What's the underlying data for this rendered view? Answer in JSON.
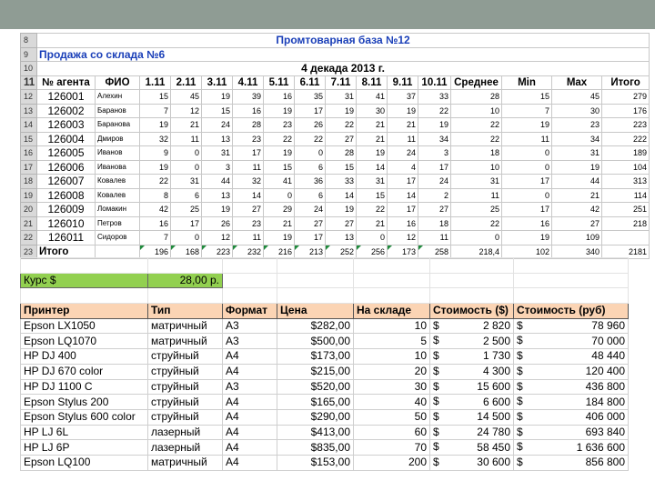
{
  "sheet1": {
    "row_numbers": [
      "8",
      "9",
      "10",
      "11",
      "12",
      "13",
      "14",
      "15",
      "16",
      "17",
      "18",
      "19",
      "20",
      "21",
      "22",
      "23"
    ],
    "title": "Промтоварная база №12",
    "subtitle": "Продажа со склада №6",
    "decade": "4 декада 2013 г.",
    "headers": [
      "№ агента",
      "ФИО",
      "1.11",
      "2.11",
      "3.11",
      "4.11",
      "5.11",
      "6.11",
      "7.11",
      "8.11",
      "9.11",
      "10.11",
      "Среднее",
      "Min",
      "Max",
      "Итого"
    ],
    "rows": [
      [
        "126001",
        "Алехин",
        "15",
        "45",
        "19",
        "39",
        "16",
        "35",
        "31",
        "41",
        "37",
        "33",
        "28",
        "15",
        "45",
        "279"
      ],
      [
        "126002",
        "Баранов",
        "7",
        "12",
        "15",
        "16",
        "19",
        "17",
        "19",
        "30",
        "19",
        "22",
        "10",
        "7",
        "30",
        "176"
      ],
      [
        "126003",
        "Баранова",
        "19",
        "21",
        "24",
        "28",
        "23",
        "26",
        "22",
        "21",
        "21",
        "19",
        "22",
        "19",
        "23",
        "223"
      ],
      [
        "126004",
        "Дмиров",
        "32",
        "11",
        "13",
        "23",
        "22",
        "22",
        "27",
        "21",
        "11",
        "34",
        "22",
        "11",
        "34",
        "222"
      ],
      [
        "126005",
        "Иванов",
        "9",
        "0",
        "31",
        "17",
        "19",
        "0",
        "28",
        "19",
        "24",
        "3",
        "18",
        "0",
        "31",
        "189"
      ],
      [
        "126006",
        "Иванова",
        "19",
        "0",
        "3",
        "11",
        "15",
        "6",
        "15",
        "14",
        "4",
        "17",
        "10",
        "0",
        "19",
        "104"
      ],
      [
        "126007",
        "Ковалев",
        "22",
        "31",
        "44",
        "32",
        "41",
        "36",
        "33",
        "31",
        "17",
        "24",
        "31",
        "17",
        "44",
        "313"
      ],
      [
        "126008",
        "Ковалев",
        "8",
        "6",
        "13",
        "14",
        "0",
        "6",
        "14",
        "15",
        "14",
        "2",
        "11",
        "0",
        "21",
        "114"
      ],
      [
        "126009",
        "Ломакин",
        "42",
        "25",
        "19",
        "27",
        "29",
        "24",
        "19",
        "22",
        "17",
        "27",
        "25",
        "17",
        "42",
        "251"
      ],
      [
        "126010",
        "Петров",
        "16",
        "17",
        "26",
        "23",
        "21",
        "27",
        "27",
        "21",
        "16",
        "18",
        "22",
        "16",
        "27",
        "218"
      ],
      [
        "126011",
        "Сидоров",
        "7",
        "0",
        "12",
        "11",
        "19",
        "17",
        "13",
        "0",
        "12",
        "11",
        "0",
        "19",
        "109"
      ]
    ],
    "total_label": "Итого",
    "totals": [
      "196",
      "168",
      "223",
      "232",
      "216",
      "213",
      "252",
      "256",
      "173",
      "258",
      "218,4",
      "102",
      "340",
      "2181"
    ]
  },
  "sheet2": {
    "kurs_label": "Курс $",
    "kurs_value": "28,00 р.",
    "headers": [
      "Принтер",
      "Тип",
      "Формат",
      "Цена",
      "На складе",
      "Стоимость ($)",
      "Стоимость (руб)"
    ],
    "currency_symbol": "$",
    "rows": [
      [
        "Epson LX1050",
        "матричный",
        "A3",
        "$282,00",
        "10",
        "2 820",
        "78 960"
      ],
      [
        "Epson LQ1070",
        "матричный",
        "A3",
        "$500,00",
        "5",
        "2 500",
        "70 000"
      ],
      [
        "HP DJ 400",
        "струйный",
        "A4",
        "$173,00",
        "10",
        "1 730",
        "48 440"
      ],
      [
        "HP DJ 670 color",
        "струйный",
        "A4",
        "$215,00",
        "20",
        "4 300",
        "120 400"
      ],
      [
        "HP DJ 1100 C",
        "струйный",
        "A3",
        "$520,00",
        "30",
        "15 600",
        "436 800"
      ],
      [
        "Epson Stylus 200",
        "струйный",
        "A4",
        "$165,00",
        "40",
        "6 600",
        "184 800"
      ],
      [
        "Epson Stylus 600 color",
        "струйный",
        "A4",
        "$290,00",
        "50",
        "14 500",
        "406 000"
      ],
      [
        "HP LJ 6L",
        "лазерный",
        "A4",
        "$413,00",
        "60",
        "24 780",
        "693 840"
      ],
      [
        "HP LJ 6P",
        "лазерный",
        "A4",
        "$835,00",
        "70",
        "58 450",
        "1 636 600"
      ],
      [
        "Epson LQ100",
        "матричный",
        "A4",
        "$153,00",
        "200",
        "30 600",
        "856 800"
      ]
    ]
  },
  "colors": {
    "topbar": "#8f9c94",
    "title_blue": "#1a3fb8",
    "kurs_green": "#92d050",
    "header_peach": "#fbd4b4",
    "row_header_gray": "#d9d9d9"
  }
}
